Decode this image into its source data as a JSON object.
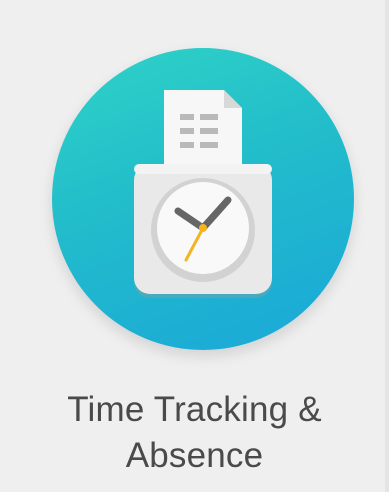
{
  "tile": {
    "label_line1": "Time Tracking &",
    "label_line2": "Absence",
    "icon": "time-tracking-clock-document-icon",
    "colors": {
      "circle_top": "#2fd3c7",
      "circle_bottom": "#1aa7d8",
      "label_text": "#4a4a4a",
      "background": "#efefef",
      "clock_second_hand": "#f5b41f"
    }
  }
}
